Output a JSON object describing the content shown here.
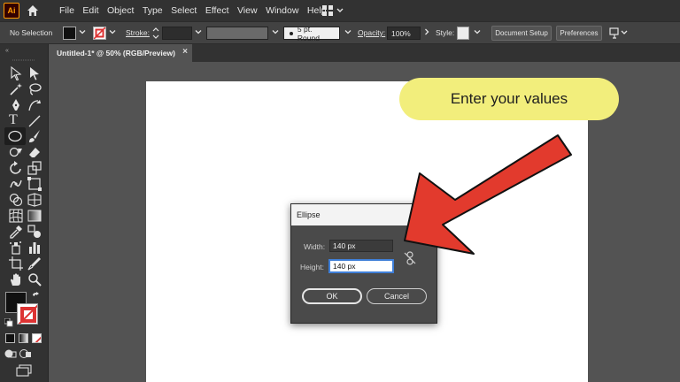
{
  "app": {
    "logo": "Ai"
  },
  "menu": [
    "File",
    "Edit",
    "Object",
    "Type",
    "Select",
    "Effect",
    "View",
    "Window",
    "Help"
  ],
  "control_bar": {
    "selection": "No Selection",
    "stroke_label": "Stroke:",
    "brush": "5 pt. Round",
    "opacity_label": "Opacity:",
    "opacity_value": "100%",
    "style_label": "Style:",
    "document_setup": "Document Setup",
    "preferences": "Preferences"
  },
  "document_tab": {
    "title": "Untitled-1* @ 50% (RGB/Preview)",
    "close": "×"
  },
  "callout": {
    "text": "Enter your values",
    "color": "#f2ee7c"
  },
  "arrow": {
    "color": "#e23a2d"
  },
  "dialog": {
    "title": "Ellipse",
    "width_label": "Width:",
    "width_value": "140 px",
    "height_label": "Height:",
    "height_value": "140 px",
    "ok_label": "OK",
    "cancel_label": "Cancel"
  }
}
